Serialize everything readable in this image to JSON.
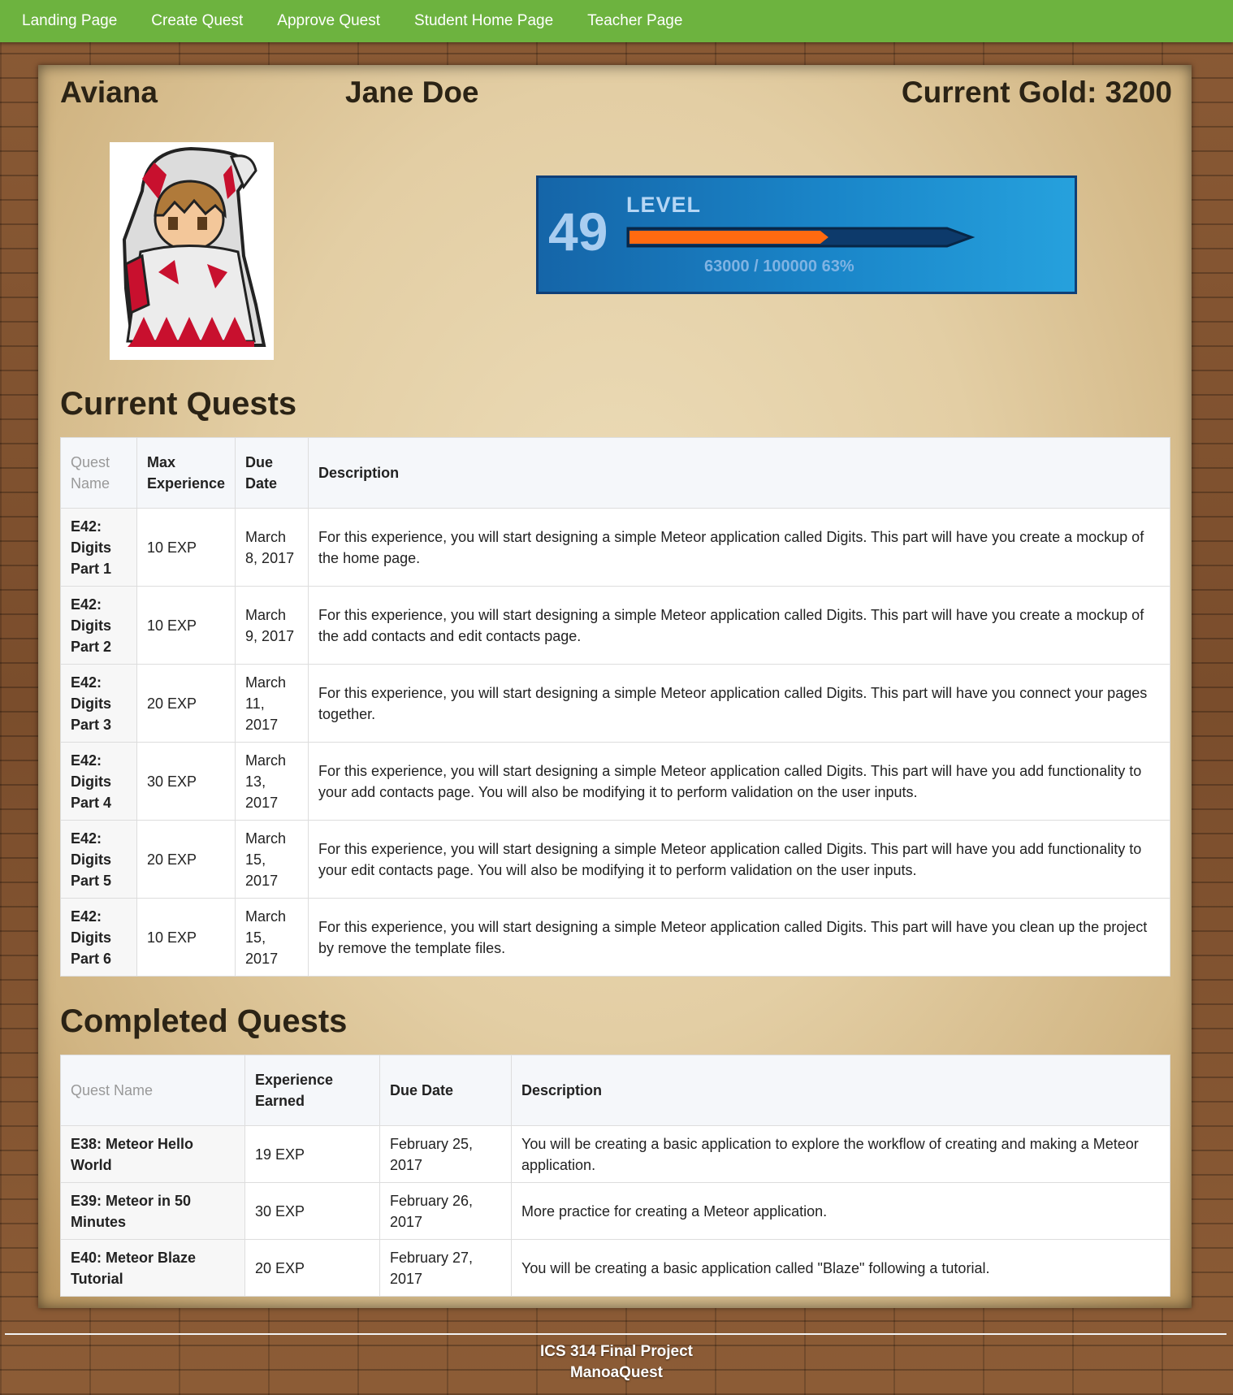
{
  "nav": {
    "links": [
      "Landing Page",
      "Create Quest",
      "Approve Quest",
      "Student Home Page",
      "Teacher Page"
    ]
  },
  "profile": {
    "character_name": "Aviana",
    "player_name": "Jane Doe",
    "gold_label": "Current Gold: 3200"
  },
  "level": {
    "value": "49",
    "label": "LEVEL",
    "progress_text": "63000 / 100000  63%",
    "progress_fraction": 0.63,
    "bar_color": "#ff6a10"
  },
  "current_quests": {
    "title": "Current Quests",
    "headers": [
      "Quest Name",
      "Max Experience",
      "Due Date",
      "Description"
    ],
    "rows": [
      {
        "name": "E42: Digits Part 1",
        "exp": "10 EXP",
        "due": "March 8, 2017",
        "desc": "For this experience, you will start designing a simple Meteor application called Digits. This part will have you create a mockup of the home page."
      },
      {
        "name": "E42: Digits Part 2",
        "exp": "10 EXP",
        "due": "March 9, 2017",
        "desc": "For this experience, you will start designing a simple Meteor application called Digits. This part will have you create a mockup of the add contacts and edit contacts page."
      },
      {
        "name": "E42: Digits Part 3",
        "exp": "20 EXP",
        "due": "March 11, 2017",
        "desc": "For this experience, you will start designing a simple Meteor application called Digits. This part will have you connect your pages together."
      },
      {
        "name": "E42: Digits Part 4",
        "exp": "30 EXP",
        "due": "March 13, 2017",
        "desc": "For this experience, you will start designing a simple Meteor application called Digits. This part will have you add functionality to your add contacts page. You will also be modifying it to perform validation on the user inputs."
      },
      {
        "name": "E42: Digits Part 5",
        "exp": "20 EXP",
        "due": "March 15, 2017",
        "desc": "For this experience, you will start designing a simple Meteor application called Digits. This part will have you add functionality to your edit contacts page. You will also be modifying it to perform validation on the user inputs."
      },
      {
        "name": "E42: Digits Part 6",
        "exp": "10 EXP",
        "due": "March 15, 2017",
        "desc": "For this experience, you will start designing a simple Meteor application called Digits. This part will have you clean up the project by remove the template files."
      }
    ]
  },
  "completed_quests": {
    "title": "Completed Quests",
    "headers": [
      "Quest Name",
      "Experience Earned",
      "Due Date",
      "Description"
    ],
    "rows": [
      {
        "name": "E38: Meteor Hello World",
        "exp": "19 EXP",
        "due": "February 25, 2017",
        "desc": "You will be creating a basic application to explore the workflow of creating and making a Meteor application."
      },
      {
        "name": "E39: Meteor in 50 Minutes",
        "exp": "30 EXP",
        "due": "February 26, 2017",
        "desc": "More practice for creating a Meteor application."
      },
      {
        "name": "E40: Meteor Blaze Tutorial",
        "exp": "20 EXP",
        "due": "February 27, 2017",
        "desc": "You will be creating a basic application called \"Blaze\" following a tutorial."
      }
    ]
  },
  "footer": {
    "line1": "ICS 314 Final Project",
    "line2": "ManoaQuest"
  }
}
